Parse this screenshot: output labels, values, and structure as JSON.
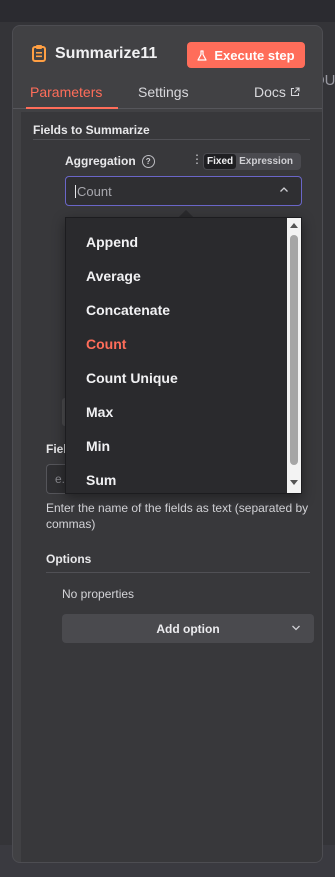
{
  "node": {
    "title": "Summarize11",
    "execute_label": "Execute step"
  },
  "tabs": [
    {
      "label": "Parameters",
      "active": true
    },
    {
      "label": "Settings",
      "active": false
    },
    {
      "label": "Docs",
      "active": false
    }
  ],
  "background": {
    "partial_text": "OU"
  },
  "fields_to_summarize": {
    "section_label": "Fields to Summarize",
    "aggregation": {
      "label": "Aggregation",
      "mode_options": [
        "Fixed",
        "Expression"
      ],
      "mode_selected": "Fixed",
      "value": "Count",
      "dropdown_options": [
        "Append",
        "Average",
        "Concatenate",
        "Count",
        "Count Unique",
        "Max",
        "Min",
        "Sum"
      ],
      "dropdown_selected": "Count"
    },
    "field": {
      "label": "Fields",
      "placeholder": "e.g."
    }
  },
  "hint": "Enter the name of the fields as text (separated by commas)",
  "options": {
    "section_label": "Options",
    "empty_text": "No properties",
    "add_label": "Add option"
  },
  "colors": {
    "accent": "#ff6d5a",
    "focus_border": "#6a66c8",
    "panel": "#414144"
  },
  "icons": [
    "clipboard-icon",
    "flask-icon",
    "external-link-icon",
    "help-icon",
    "kebab-icon",
    "chevron-up-icon",
    "chevron-down-icon"
  ]
}
